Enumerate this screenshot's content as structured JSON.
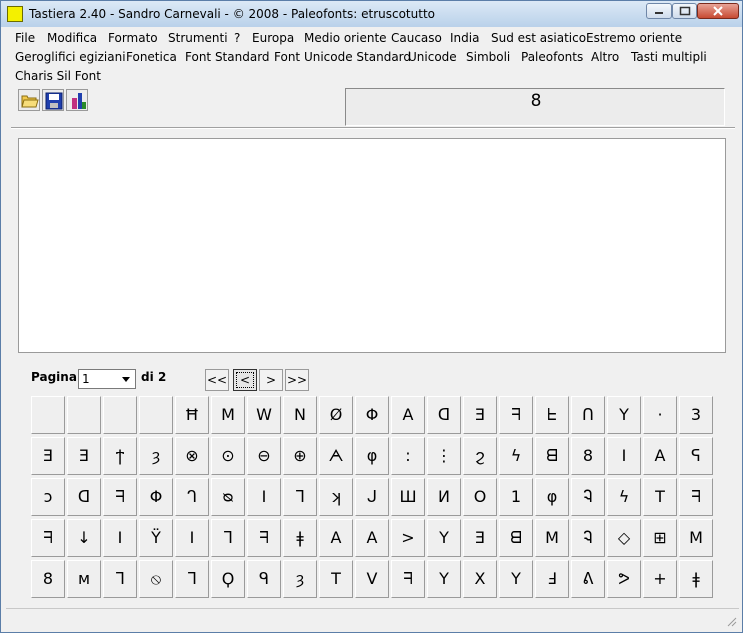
{
  "window": {
    "title": "Tastiera 2.40 - Sandro Carnevali - ©  2008 - Paleofonts: etruscotutto"
  },
  "menus": [
    "File",
    "Modifica",
    "Formato",
    "Strumenti",
    "?",
    "Europa",
    "Medio oriente",
    "Caucaso",
    "India",
    "Sud est asiatico",
    "Estremo oriente",
    "Geroglifici egiziani",
    "Fonetica",
    "Font Standard",
    "Font Unicode Standard",
    "Unicode",
    "Simboli",
    "Paleofonts",
    "Altro",
    "Tasti multipli",
    "Charis Sil Font"
  ],
  "toolbar": {
    "buttons": [
      "open-folder-icon",
      "save-disk-icon",
      "font-tool-icon"
    ]
  },
  "preview": {
    "char": "8"
  },
  "editor": {
    "text": ""
  },
  "pagination": {
    "label": "Pagina",
    "current": "1",
    "of_label": "di",
    "total": "2",
    "first": "<<",
    "prev": "<",
    "next": ">",
    "last": ">>"
  },
  "keys": [
    [
      "",
      "",
      "",
      "",
      "Ħ",
      "M",
      "W",
      "N",
      "Ø",
      "Φ",
      "A",
      "ᗡ",
      "Ǝ",
      "ᖷ",
      "ᖶ",
      "ᑎ",
      "Y",
      "·",
      "3"
    ],
    [
      "Ǝ",
      "Ǝ",
      "ϯ",
      "ȝ",
      "⊗",
      "⊙",
      "⊖",
      "⊕",
      "ᗅ",
      "φ",
      ":",
      "⋮",
      "ϩ",
      "ϟ",
      "ᗺ",
      "8",
      "I",
      "A",
      "ᕋ"
    ],
    [
      "ↄ",
      "ᗡ",
      "ᖷ",
      "Φ",
      "ᒉ",
      "ᴓ",
      "I",
      "ᒣ",
      "ʞ",
      "ᒍ",
      "Ш",
      "И",
      "O",
      "1",
      "φ",
      "Ꮈ",
      "ϟ",
      "T",
      "ᖷ"
    ],
    [
      "ᖷ",
      "↓",
      "I",
      "Ϋ",
      "I",
      "ᒣ",
      "ᖷ",
      "ǂ",
      "A",
      "A",
      ">",
      "Υ",
      "Ǝ",
      "ᗺ",
      "M",
      "Ꮈ",
      "◇",
      "⊞",
      "M"
    ],
    [
      "8",
      "ᴍ",
      "ᒣ",
      "⦸",
      "ᒣ",
      "Ϙ",
      "ᑫ",
      "ȝ",
      "T",
      "V",
      "ᖷ",
      "Υ",
      "X",
      "Υ",
      "Ⅎ",
      "ᕕ",
      "ᕗ",
      "+",
      "ǂ"
    ]
  ]
}
